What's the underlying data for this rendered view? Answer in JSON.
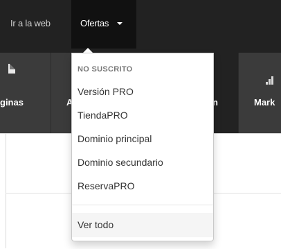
{
  "topbar": {
    "link_web": "Ir a la web",
    "link_ofertas": "Ofertas"
  },
  "iconbar": {
    "paginas_partial": "ginas",
    "partial_a": "A",
    "partial_n": "n",
    "marketing_partial": "Mark"
  },
  "dropdown": {
    "header": "NO SUSCRITO",
    "items": [
      "Versión PRO",
      "TiendaPRO",
      "Dominio principal",
      "Dominio secundario",
      "ReservaPRO"
    ],
    "footer": "Ver todo"
  },
  "colors": {
    "topbar": "#222222",
    "iconbar": "#3b3b3b",
    "menu_bg": "#ffffff"
  }
}
